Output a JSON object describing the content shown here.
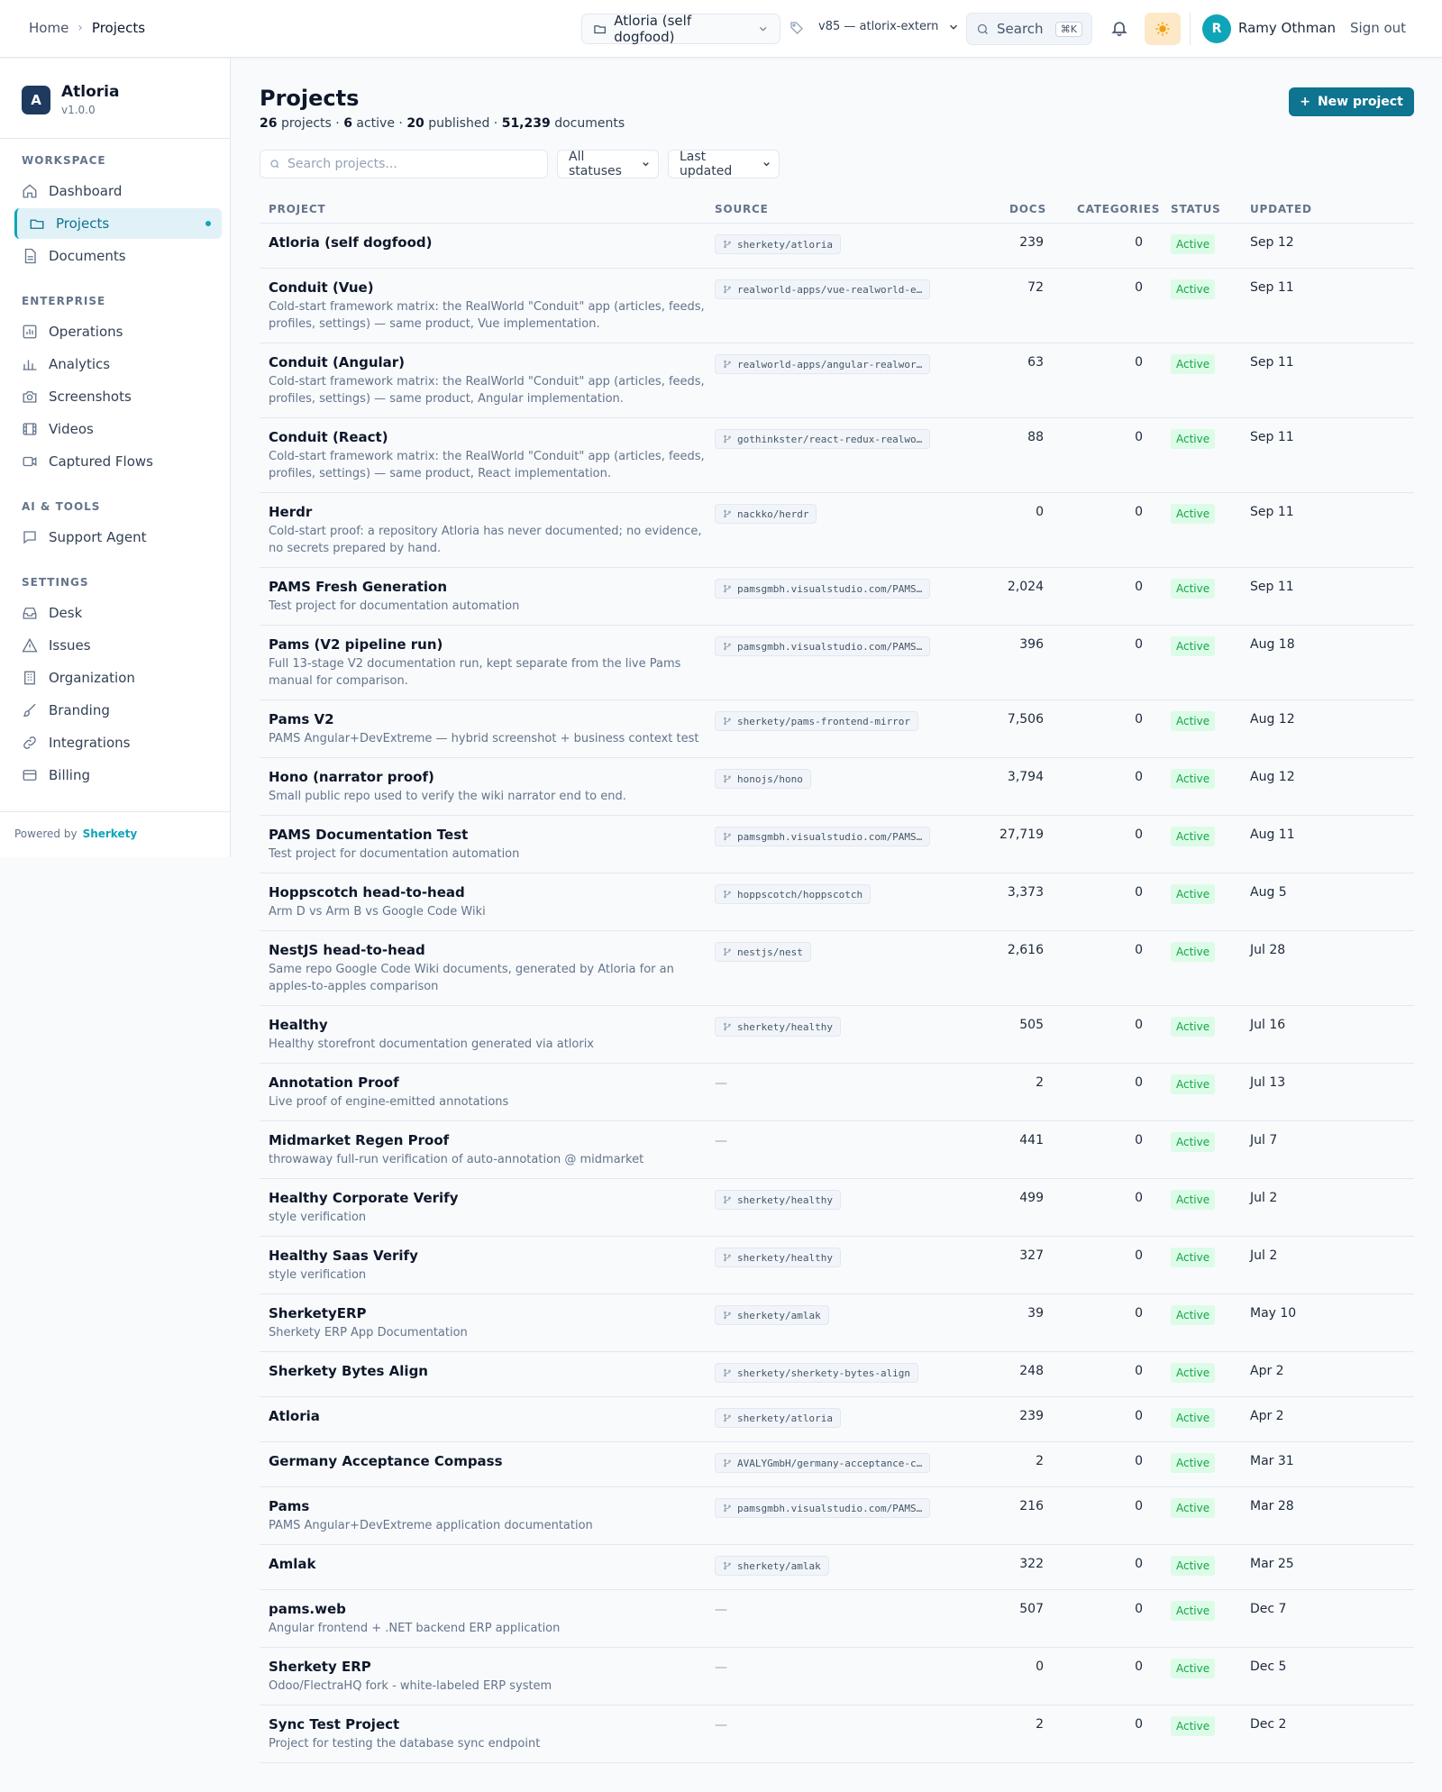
{
  "topbar": {
    "breadcrumb": [
      "Home",
      "Projects"
    ],
    "project_selector": "Atloria (self dogfood)",
    "version_selector": "v85 — atlorix-extern",
    "search_label": "Search",
    "search_shortcut": "⌘K",
    "user_initial": "R",
    "user_name": "Ramy Othman",
    "signout_label": "Sign out"
  },
  "sidebar": {
    "brand_name": "Atloria",
    "brand_version": "v1.0.0",
    "brand_initial": "A",
    "sections": {
      "workspace": "WORKSPACE",
      "enterprise": "ENTERPRISE",
      "ai_tools": "AI & TOOLS",
      "settings": "SETTINGS"
    },
    "items": {
      "dashboard": "Dashboard",
      "projects": "Projects",
      "documents": "Documents",
      "operations": "Operations",
      "analytics": "Analytics",
      "screenshots": "Screenshots",
      "videos": "Videos",
      "captured_flows": "Captured Flows",
      "support_agent": "Support Agent",
      "desk": "Desk",
      "issues": "Issues",
      "organization": "Organization",
      "branding": "Branding",
      "integrations": "Integrations",
      "billing": "Billing"
    },
    "powered_by_label": "Powered by",
    "powered_by_brand": "Sherkety"
  },
  "main": {
    "title": "Projects",
    "summary": {
      "projects_count": "26",
      "projects_label": "projects ·",
      "active_count": "6",
      "active_label": "active ·",
      "published_count": "20",
      "published_label": "published ·",
      "documents_count": "51,239",
      "documents_label": "documents"
    },
    "new_project_label": "New project",
    "search_placeholder": "Search projects...",
    "status_filter": "All statuses",
    "sort_filter": "Last updated",
    "columns": {
      "project": "PROJECT",
      "source": "SOURCE",
      "docs": "DOCS",
      "categories": "CATEGORIES",
      "status": "STATUS",
      "updated": "UPDATED"
    },
    "rows": [
      {
        "name": "Atloria (self dogfood)",
        "desc": "",
        "source": "sherkety/atloria",
        "docs": "239",
        "categories": "0",
        "status": "Active",
        "updated": "Sep 12"
      },
      {
        "name": "Conduit (Vue)",
        "desc": "Cold-start framework matrix: the RealWorld \"Conduit\" app (articles, feeds, profiles, settings) — same product, Vue implementation.",
        "source": "realworld-apps/vue-realworld-e…",
        "docs": "72",
        "categories": "0",
        "status": "Active",
        "updated": "Sep 11"
      },
      {
        "name": "Conduit (Angular)",
        "desc": "Cold-start framework matrix: the RealWorld \"Conduit\" app (articles, feeds, profiles, settings) — same product, Angular implementation.",
        "source": "realworld-apps/angular-realwor…",
        "docs": "63",
        "categories": "0",
        "status": "Active",
        "updated": "Sep 11"
      },
      {
        "name": "Conduit (React)",
        "desc": "Cold-start framework matrix: the RealWorld \"Conduit\" app (articles, feeds, profiles, settings) — same product, React implementation.",
        "source": "gothinkster/react-redux-realwo…",
        "docs": "88",
        "categories": "0",
        "status": "Active",
        "updated": "Sep 11"
      },
      {
        "name": "Herdr",
        "desc": "Cold-start proof: a repository Atloria has never documented; no evidence, no secrets prepared by hand.",
        "source": "nackko/herdr",
        "docs": "0",
        "categories": "0",
        "status": "Active",
        "updated": "Sep 11"
      },
      {
        "name": "PAMS Fresh Generation",
        "desc": "Test project for documentation automation",
        "source": "pamsgmbh.visualstudio.com/PAMS…",
        "docs": "2,024",
        "categories": "0",
        "status": "Active",
        "updated": "Sep 11"
      },
      {
        "name": "Pams (V2 pipeline run)",
        "desc": "Full 13-stage V2 documentation run, kept separate from the live Pams manual for comparison.",
        "source": "pamsgmbh.visualstudio.com/PAMS…",
        "docs": "396",
        "categories": "0",
        "status": "Active",
        "updated": "Aug 18"
      },
      {
        "name": "Pams V2",
        "desc": "PAMS Angular+DevExtreme — hybrid screenshot + business context test",
        "source": "sherkety/pams-frontend-mirror",
        "docs": "7,506",
        "categories": "0",
        "status": "Active",
        "updated": "Aug 12"
      },
      {
        "name": "Hono (narrator proof)",
        "desc": "Small public repo used to verify the wiki narrator end to end.",
        "source": "honojs/hono",
        "docs": "3,794",
        "categories": "0",
        "status": "Active",
        "updated": "Aug 12"
      },
      {
        "name": "PAMS Documentation Test",
        "desc": "Test project for documentation automation",
        "source": "pamsgmbh.visualstudio.com/PAMS…",
        "docs": "27,719",
        "categories": "0",
        "status": "Active",
        "updated": "Aug 11"
      },
      {
        "name": "Hoppscotch head-to-head",
        "desc": "Arm D vs Arm B vs Google Code Wiki",
        "source": "hoppscotch/hoppscotch",
        "docs": "3,373",
        "categories": "0",
        "status": "Active",
        "updated": "Aug 5"
      },
      {
        "name": "NestJS head-to-head",
        "desc": "Same repo Google Code Wiki documents, generated by Atloria for an apples-to-apples comparison",
        "source": "nestjs/nest",
        "docs": "2,616",
        "categories": "0",
        "status": "Active",
        "updated": "Jul 28"
      },
      {
        "name": "Healthy",
        "desc": "Healthy storefront documentation generated via atlorix",
        "source": "sherkety/healthy",
        "docs": "505",
        "categories": "0",
        "status": "Active",
        "updated": "Jul 16"
      },
      {
        "name": "Annotation Proof",
        "desc": "Live proof of engine-emitted annotations",
        "source": "—",
        "docs": "2",
        "categories": "0",
        "status": "Active",
        "updated": "Jul 13"
      },
      {
        "name": "Midmarket Regen Proof",
        "desc": "throwaway full-run verification of auto-annotation @ midmarket",
        "source": "—",
        "docs": "441",
        "categories": "0",
        "status": "Active",
        "updated": "Jul 7"
      },
      {
        "name": "Healthy Corporate Verify",
        "desc": "style verification",
        "source": "sherkety/healthy",
        "docs": "499",
        "categories": "0",
        "status": "Active",
        "updated": "Jul 2"
      },
      {
        "name": "Healthy Saas Verify",
        "desc": "style verification",
        "source": "sherkety/healthy",
        "docs": "327",
        "categories": "0",
        "status": "Active",
        "updated": "Jul 2"
      },
      {
        "name": "SherketyERP",
        "desc": "Sherkety ERP App Documentation",
        "source": "sherkety/amlak",
        "docs": "39",
        "categories": "0",
        "status": "Active",
        "updated": "May 10"
      },
      {
        "name": "Sherkety Bytes Align",
        "desc": "",
        "source": "sherkety/sherkety-bytes-align",
        "docs": "248",
        "categories": "0",
        "status": "Active",
        "updated": "Apr 2"
      },
      {
        "name": "Atloria",
        "desc": "",
        "source": "sherkety/atloria",
        "docs": "239",
        "categories": "0",
        "status": "Active",
        "updated": "Apr 2"
      },
      {
        "name": "Germany Acceptance Compass",
        "desc": "",
        "source": "AVALYGmbH/germany-acceptance-c…",
        "docs": "2",
        "categories": "0",
        "status": "Active",
        "updated": "Mar 31"
      },
      {
        "name": "Pams",
        "desc": "PAMS Angular+DevExtreme application documentation",
        "source": "pamsgmbh.visualstudio.com/PAMS…",
        "docs": "216",
        "categories": "0",
        "status": "Active",
        "updated": "Mar 28"
      },
      {
        "name": "Amlak",
        "desc": "",
        "source": "sherkety/amlak",
        "docs": "322",
        "categories": "0",
        "status": "Active",
        "updated": "Mar 25"
      },
      {
        "name": "pams.web",
        "desc": "Angular frontend + .NET backend ERP application",
        "source": "—",
        "docs": "507",
        "categories": "0",
        "status": "Active",
        "updated": "Dec 7"
      },
      {
        "name": "Sherkety ERP",
        "desc": "Odoo/FlectraHQ fork - white-labeled ERP system",
        "source": "—",
        "docs": "0",
        "categories": "0",
        "status": "Active",
        "updated": "Dec 5"
      },
      {
        "name": "Sync Test Project",
        "desc": "Project for testing the database sync endpoint",
        "source": "—",
        "docs": "2",
        "categories": "0",
        "status": "Active",
        "updated": "Dec 2"
      }
    ]
  }
}
